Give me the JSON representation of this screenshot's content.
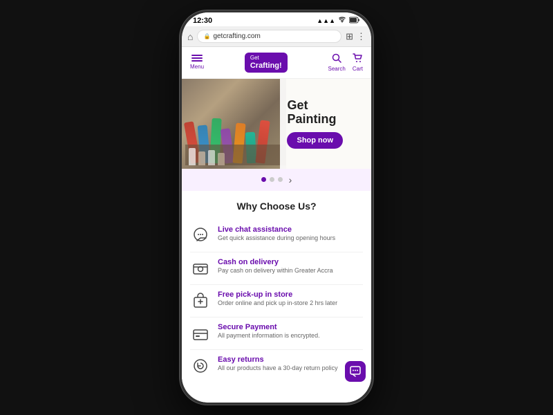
{
  "status_bar": {
    "time": "12:30",
    "signal": "▲▲▲",
    "wifi": "WiFi",
    "battery": "🔋"
  },
  "browser": {
    "url": "getcrafting.com",
    "tab_icon": "⊞",
    "more_icon": "⋮",
    "home_icon": "⌂",
    "lock_icon": "🔒"
  },
  "nav": {
    "menu_label": "Menu",
    "logo_get": "Get",
    "logo_crafting": "Crafting!",
    "search_label": "Search",
    "cart_label": "Cart"
  },
  "hero": {
    "title_line1": "Get",
    "title_line2": "Painting",
    "shop_now": "Shop now",
    "carousel_dots": [
      true,
      false,
      false
    ],
    "arrow": "›"
  },
  "why_section": {
    "title": "Why Choose Us?",
    "features": [
      {
        "id": "live-chat",
        "icon": "💬",
        "name": "Live chat assistance",
        "desc": "Get quick assistance during opening hours"
      },
      {
        "id": "cash-delivery",
        "icon": "💵",
        "name": "Cash on delivery",
        "desc": "Pay cash on delivery within Greater Accra"
      },
      {
        "id": "pickup",
        "icon": "🛍",
        "name": "Free pick-up in store",
        "desc": "Order online and pick up in-store 2 hrs later"
      },
      {
        "id": "secure-payment",
        "icon": "💳",
        "name": "Secure Payment",
        "desc": "All payment information is encrypted."
      },
      {
        "id": "easy-returns",
        "icon": "🔄",
        "name": "Easy returns",
        "desc": "All our products have a 30-day return policy"
      }
    ]
  },
  "chat_fab": {
    "icon": "💬"
  }
}
